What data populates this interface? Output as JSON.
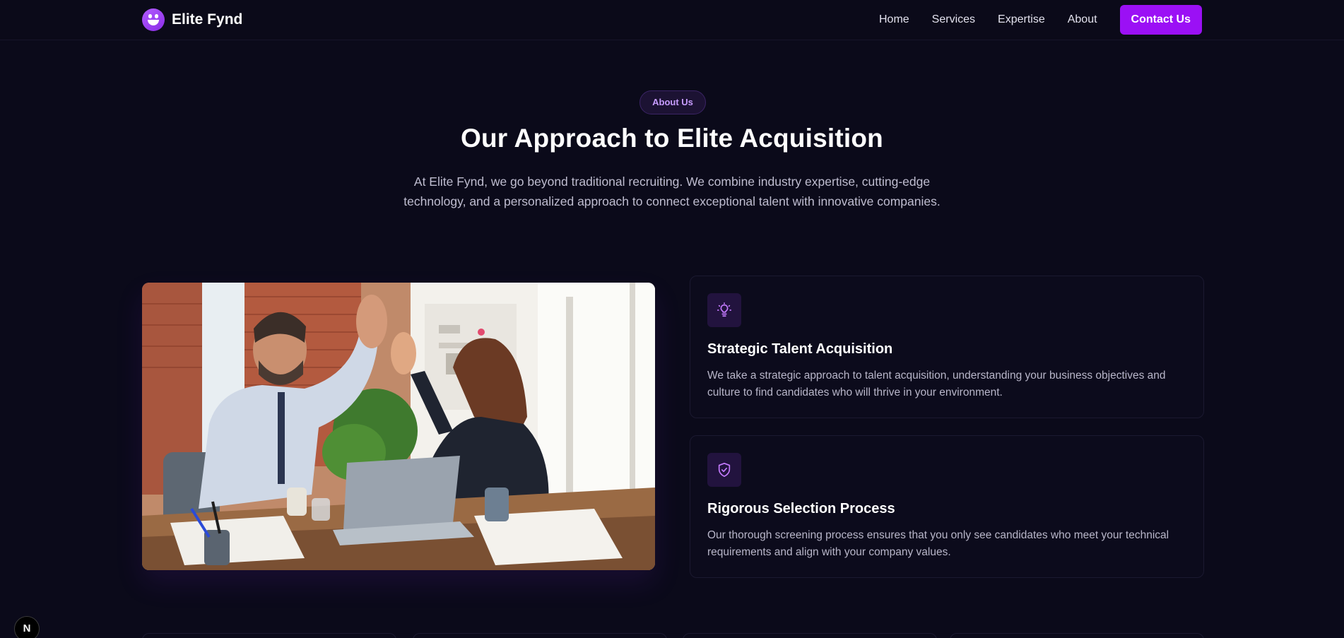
{
  "brand": {
    "name": "Elite Fynd"
  },
  "nav": {
    "links": [
      "Home",
      "Services",
      "Expertise",
      "About"
    ],
    "cta": "Contact Us"
  },
  "hero": {
    "badge": "About Us",
    "title": "Our Approach to Elite Acquisition",
    "lead": "At Elite Fynd, we go beyond traditional recruiting. We combine industry expertise, cutting-edge technology, and a personalized approach to connect exceptional talent with innovative companies."
  },
  "photo": {
    "subject": "two colleagues high-fiving at an office desk"
  },
  "cards": [
    {
      "icon": "lightbulb-icon",
      "title": "Strategic Talent Acquisition",
      "text": "We take a strategic approach to talent acquisition, understanding your business objectives and culture to find candidates who will thrive in your environment."
    },
    {
      "icon": "shield-check-icon",
      "title": "Rigorous Selection Process",
      "text": "Our thorough screening process ensures that you only see candidates who meet your technical requirements and align with your company values."
    }
  ],
  "dev_badge": "N",
  "colors": {
    "accent": "#9b10f5",
    "background": "#0b0a1a",
    "badge_text": "#c79cff"
  }
}
